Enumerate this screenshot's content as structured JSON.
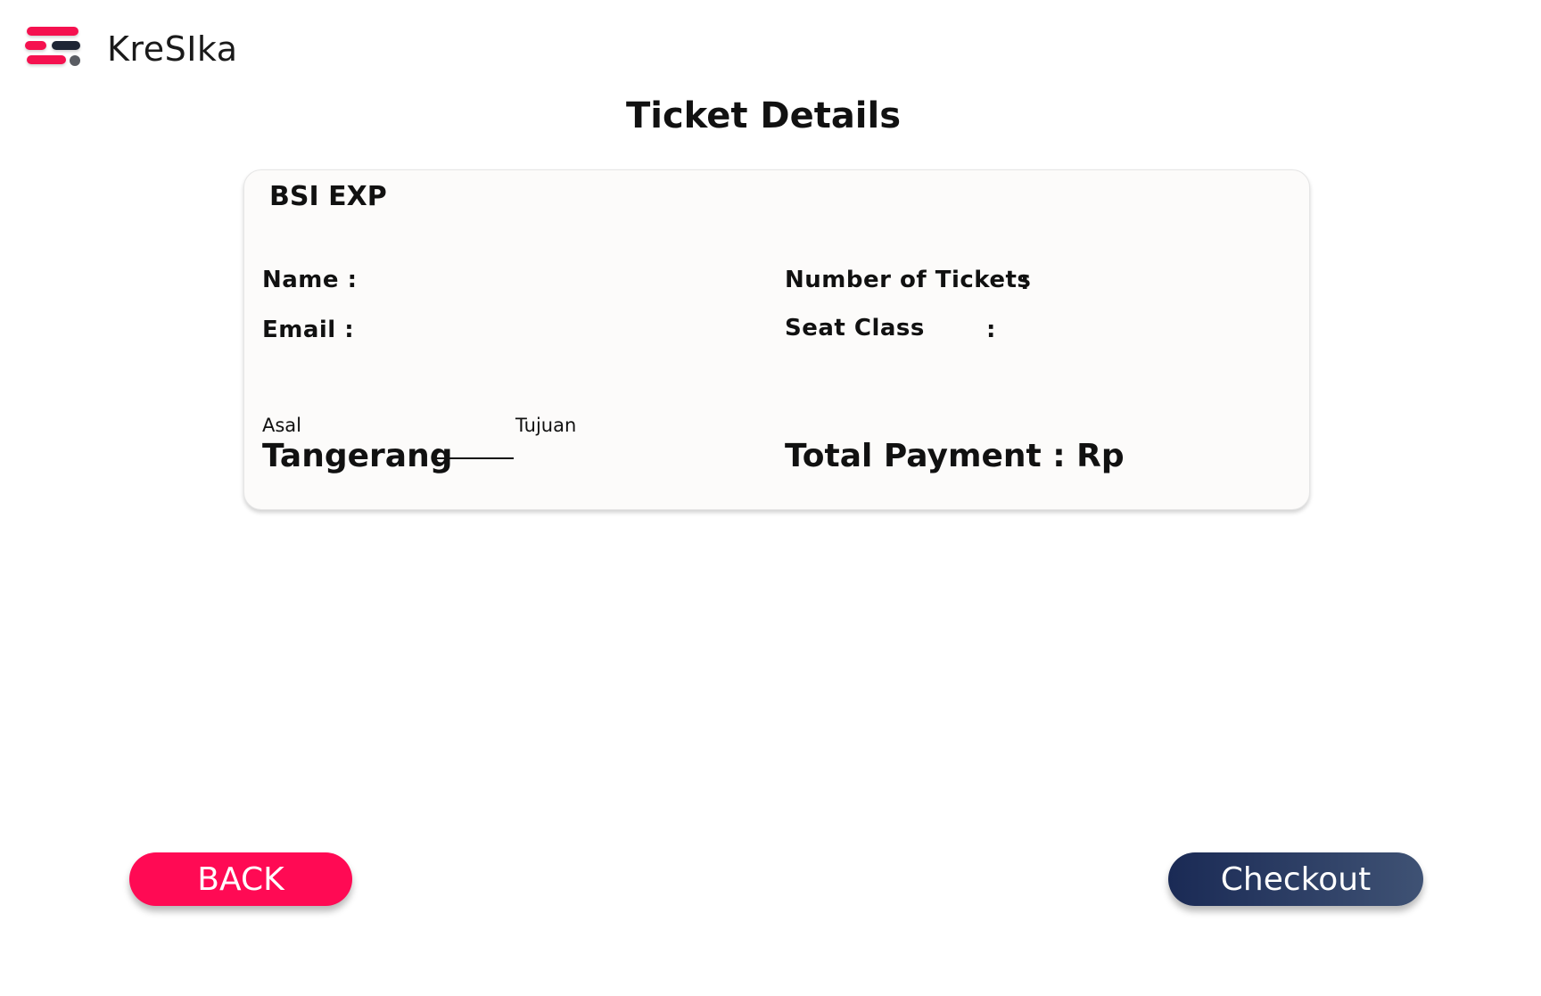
{
  "app": {
    "brand_name": "KreSIka"
  },
  "page": {
    "title": "Ticket Details"
  },
  "ticket": {
    "train_name": "BSI EXP",
    "name_label": "Name :",
    "email_label": "Email  :",
    "tickets_label": "Number of Tickets",
    "tickets_colon": ":",
    "seat_label": "Seat Class",
    "seat_colon": ":",
    "origin_label": "Asal",
    "origin_value": "Tangerang",
    "destination_label": "Tujuan",
    "total_label": "Total Payment : Rp"
  },
  "actions": {
    "back_label": "BACK",
    "checkout_label": "Checkout"
  },
  "colors": {
    "accent": "#ff0a54",
    "dark": "#1e2535",
    "checkout_start": "#1a2a55",
    "checkout_end": "#3f5274"
  }
}
